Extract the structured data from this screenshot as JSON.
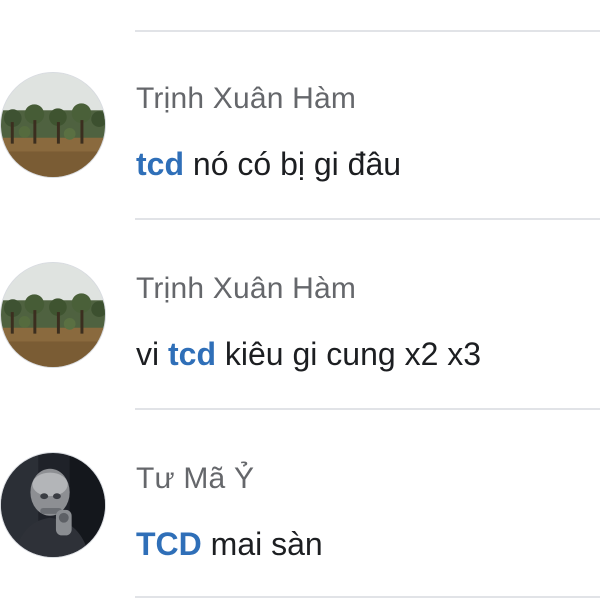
{
  "comments": [
    {
      "author": "Trịnh Xuân Hàm",
      "avatar_icon": "orchard-photo-avatar",
      "prefix": "",
      "mention": "tcd",
      "text": " nó có bị gi đâu"
    },
    {
      "author": "Trịnh Xuân Hàm",
      "avatar_icon": "orchard-photo-avatar",
      "prefix": "vi ",
      "mention": "tcd",
      "text": " kiêu gi cung x2 x3"
    },
    {
      "author": "Tư Mã Ỷ",
      "avatar_icon": "portrait-photo-avatar",
      "prefix": "",
      "mention": "TCD",
      "text": " mai sàn"
    }
  ],
  "colors": {
    "mention": "#2f6fb8",
    "author": "#65676b",
    "text": "#1c1e21",
    "divider": "#e1e3e7"
  }
}
